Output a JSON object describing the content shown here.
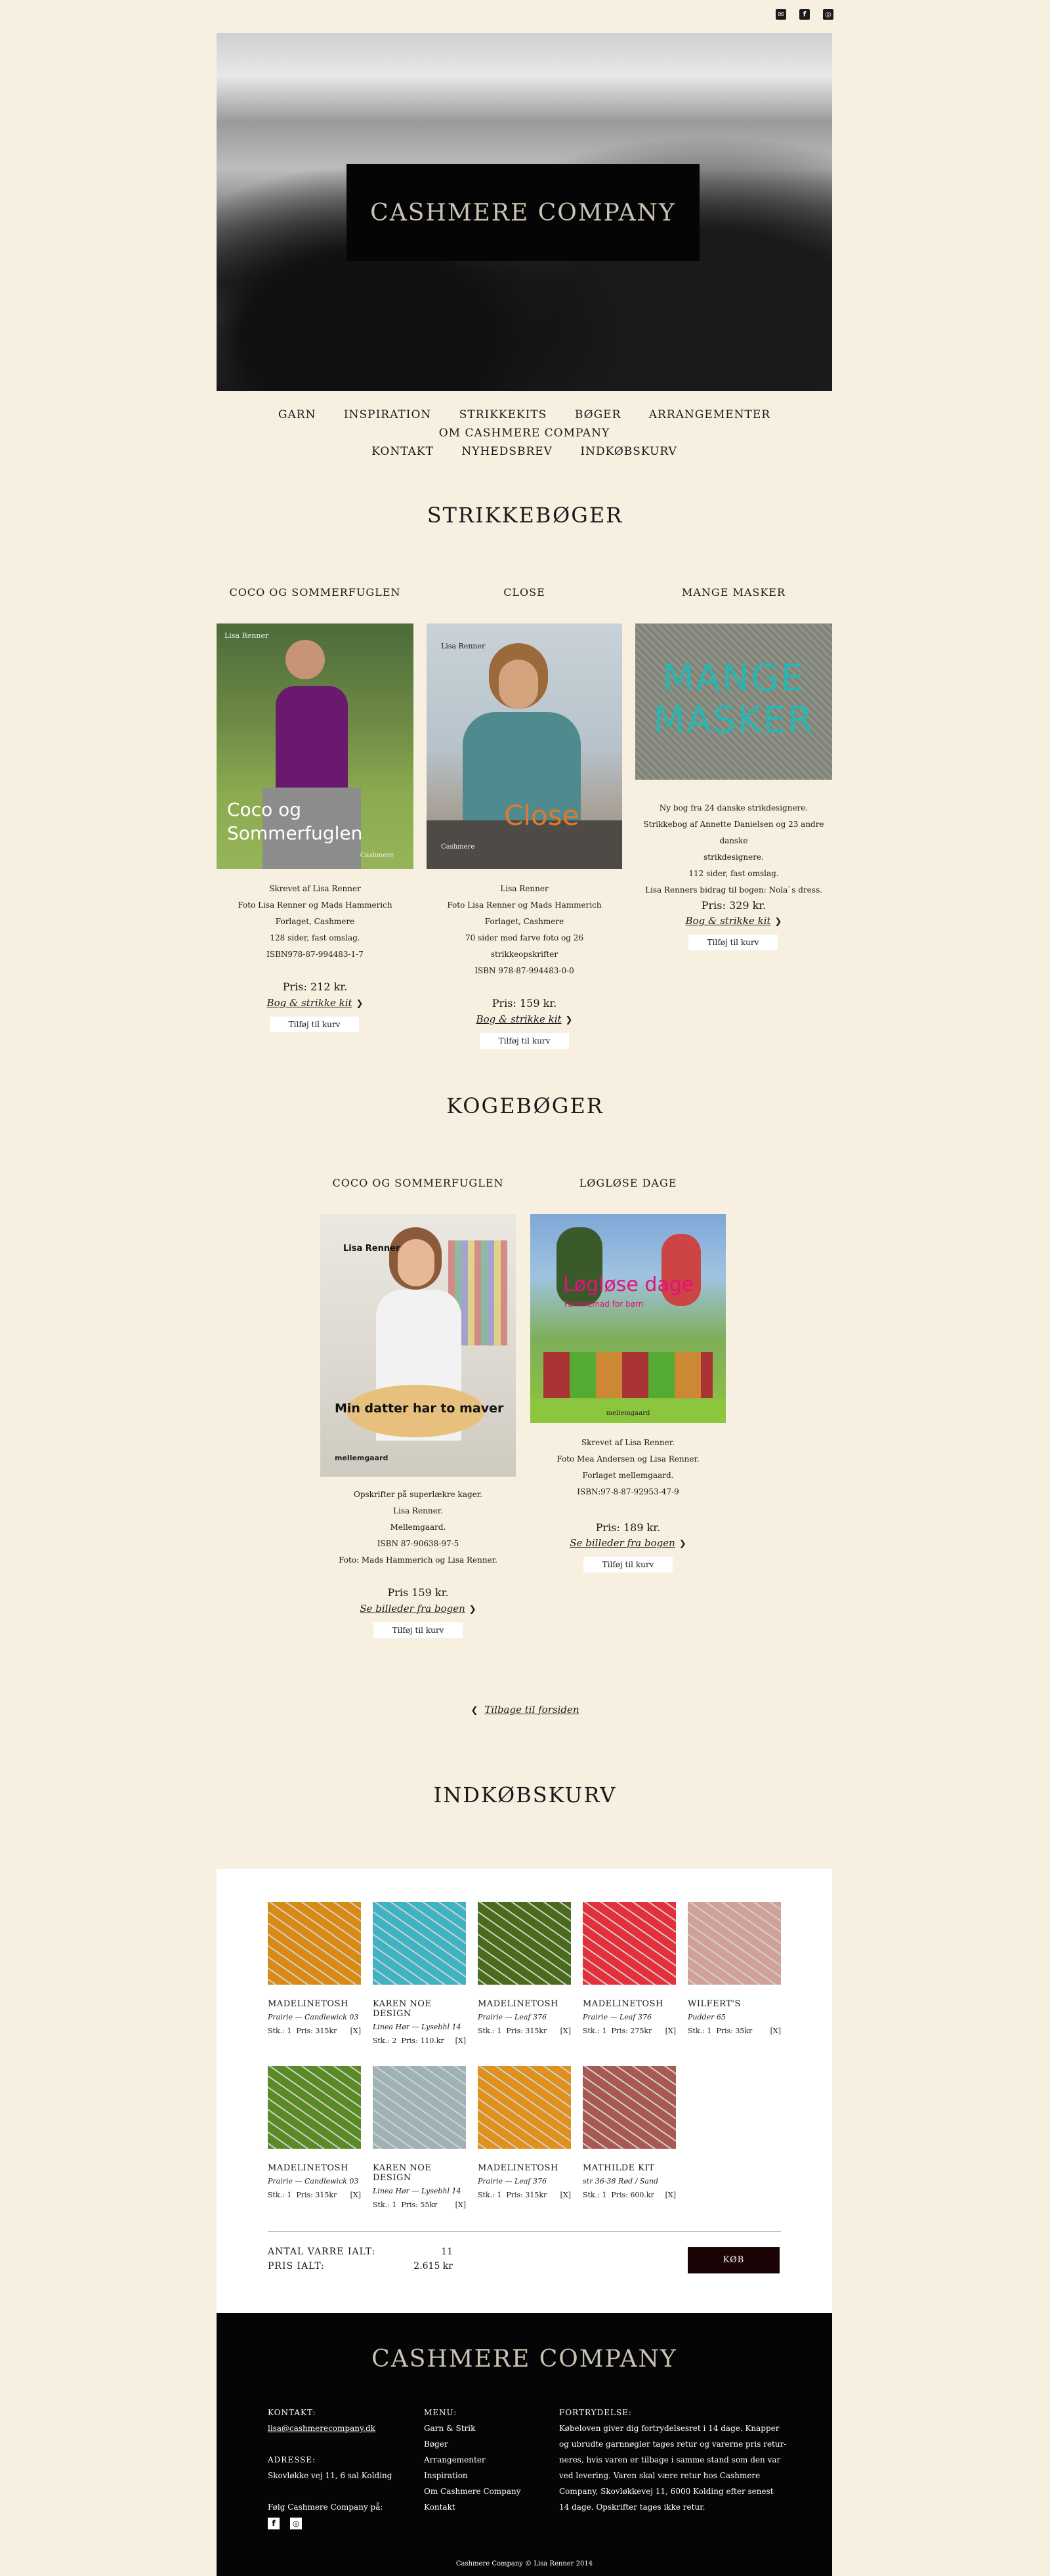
{
  "social": {
    "icons": [
      "mail-icon",
      "facebook-icon",
      "instagram-icon"
    ]
  },
  "hero": {
    "brand": "CASHMERE COMPANY"
  },
  "nav": {
    "items": [
      "GARN",
      "INSPIRATION",
      "STRIKKEKITS",
      "BØGER",
      "ARRANGEMENTER",
      "OM CASHMERE COMPANY",
      "KONTAKT",
      "NYHEDSBREV",
      "INDKØBSKURV"
    ]
  },
  "knit": {
    "title": "STRIKKEBØGER",
    "products": [
      {
        "name": "COCO OG SOMMERFUGLEN",
        "cover_text": "Coco og Sommerfuglen",
        "cover_author": "Lisa Renner",
        "cover_pub": "Cashmere",
        "desc": [
          "Skrevet af Lisa Renner",
          "Foto Lisa Renner og Mads Hammerich",
          "Forlaget, Cashmere",
          "128 sider, fast omslag.",
          "ISBN978-87-994483-1-7"
        ],
        "price": "Pris: 212 kr.",
        "link": "Bog & strikke kit",
        "button": "Tilføj til kurv"
      },
      {
        "name": "CLOSE",
        "cover_text": "Close",
        "cover_author": "Lisa Renner",
        "cover_pub": "Cashmere",
        "desc": [
          "Lisa Renner",
          "Foto Lisa Renner og Mads Hammerich",
          "Forlaget, Cashmere",
          "70 sider med farve foto og 26",
          "strikkeopskrifter",
          "ISBN 978-87-994483-0-0"
        ],
        "price": "Pris: 159 kr.",
        "link": "Bog & strikke kit",
        "button": "Tilføj til kurv"
      },
      {
        "name": "MANGE MASKER",
        "cover_text": "MANGE MASKER",
        "desc": [
          "Ny bog fra 24 danske strikdesignere.",
          "Strikkebog af Annette Danielsen og 23 andre danske",
          "strikdesignere.",
          "112 sider, fast omslag.",
          "Lisa Renners bidrag til bogen: Nola`s dress."
        ],
        "price": "Pris: 329 kr.",
        "link": "Bog & strikke kit",
        "button": "Tilføj til kurv"
      }
    ]
  },
  "cook": {
    "title": "KOGEBØGER",
    "products": [
      {
        "name": "COCO OG SOMMERFUGLEN",
        "cover_author": "Lisa Renner",
        "cover_text": "Min datter har to maver",
        "cover_pub": "mellemgaard",
        "desc": [
          "Opskrifter på superlækre kager.",
          "Lisa Renner.",
          "Mellemgaard.",
          "ISBN 87-90638-97-5",
          "Foto: Mads Hammerich og Lisa Renner."
        ],
        "price": "Pris 159 kr.",
        "link": "Se billeder fra bogen",
        "button": "Tilføj til kurv"
      },
      {
        "name": "LØGLØSE DAGE",
        "cover_text": "Løgløse dage",
        "cover_sub": "Familiemad for børn",
        "cover_pub": "mellemgaard",
        "desc": [
          "Skrevet af Lisa Renner.",
          "Foto Mea Andersen og Lisa Renner.",
          "Forlaget mellemgaard.",
          "ISBN:97-8-87-92953-47-9"
        ],
        "price": "Pris: 189 kr.",
        "link": "Se billeder fra bogen",
        "button": "Tilføj til kurv"
      }
    ]
  },
  "back": {
    "label": "Tilbage til forsiden"
  },
  "cart": {
    "title": "INDKØBSKURV",
    "items": [
      {
        "brand": "MADELINETOSH",
        "variant": "Prairie — Candlewick 03",
        "qty": "Stk.: 1",
        "price": "Pris: 315kr",
        "remove": "[X]",
        "color": "#d98a12"
      },
      {
        "brand": "KAREN NOE DESIGN",
        "variant": "Linea Hør — Lysebhl 14",
        "qty": "Stk.: 2",
        "price": "Pris: 110.kr",
        "remove": "[X]",
        "color": "#3fb3c4"
      },
      {
        "brand": "MADELINETOSH",
        "variant": "Prairie — Leaf 376",
        "qty": "Stk.: 1",
        "price": "Pris: 315kr",
        "remove": "[X]",
        "color": "#4a6a1c"
      },
      {
        "brand": "MADELINETOSH",
        "variant": "Prairie — Leaf 376",
        "qty": "Stk.: 1",
        "price": "Pris: 275kr",
        "remove": "[X]",
        "color": "#e3303a"
      },
      {
        "brand": "WILFERT'S",
        "variant": "Pudder 65",
        "qty": "Stk.: 1",
        "price": "Pris: 35kr",
        "remove": "[X]",
        "color": "#cfa199"
      },
      {
        "brand": "MADELINETOSH",
        "variant": "Prairie — Candlewick 03",
        "qty": "Stk.: 1",
        "price": "Pris: 315kr",
        "remove": "[X]",
        "color": "#5a8a24"
      },
      {
        "brand": "KAREN NOE DESIGN",
        "variant": "Linea Hør — Lysebhl 14",
        "qty": "Stk.: 1",
        "price": "Pris: 55kr",
        "remove": "[X]",
        "color": "#9fb3b6"
      },
      {
        "brand": "MADELINETOSH",
        "variant": "Prairie — Leaf 376",
        "qty": "Stk.: 1",
        "price": "Pris: 315kr",
        "remove": "[X]",
        "color": "#e0901c"
      },
      {
        "brand": "MATHILDE KIT",
        "variant": "str 36-38  Rød / Sand",
        "qty": "Stk.: 1",
        "price": "Pris: 600.kr",
        "remove": "[X]",
        "color": "#a85a52"
      }
    ],
    "total_items_label": "ANTAL VARRE IALT:",
    "total_items_value": "11",
    "total_price_label": "PRIS IALT:",
    "total_price_value": "2.615 kr",
    "buy_label": "KØB"
  },
  "footer": {
    "brand": "CASHMERE COMPANY",
    "contact_h": "KONTAKT:",
    "contact_email": "lisa@cashmerecompany.dk",
    "address_h": "ADRESSE:",
    "address": "Skovløkke vej 11, 6 sal Kolding",
    "follow": "Følg Cashmere Company på:",
    "menu_h": "MENU:",
    "menu": [
      "Garn & Strik",
      "Bøger",
      "Arrangementer",
      "Inspiration",
      "Om Cashmere Company",
      "Kontakt"
    ],
    "terms_h": "FORTRYDELSE:",
    "terms": [
      "Købeloven giver dig fortrydelsesret i 14 dage. Knapper",
      "og ubrudte garnnøgler tages retur og varerne pris retur-",
      "neres, hvis varen er tilbage i samme stand som den var",
      "ved levering. Varen skal være retur hos Cashmere",
      "Company, Skovløkkevej 11, 6000 Kolding efter senest",
      "14 dage. Opskrifter tages ikke retur."
    ],
    "copyright": "Cashmere Company © Lisa Renner 2014"
  }
}
